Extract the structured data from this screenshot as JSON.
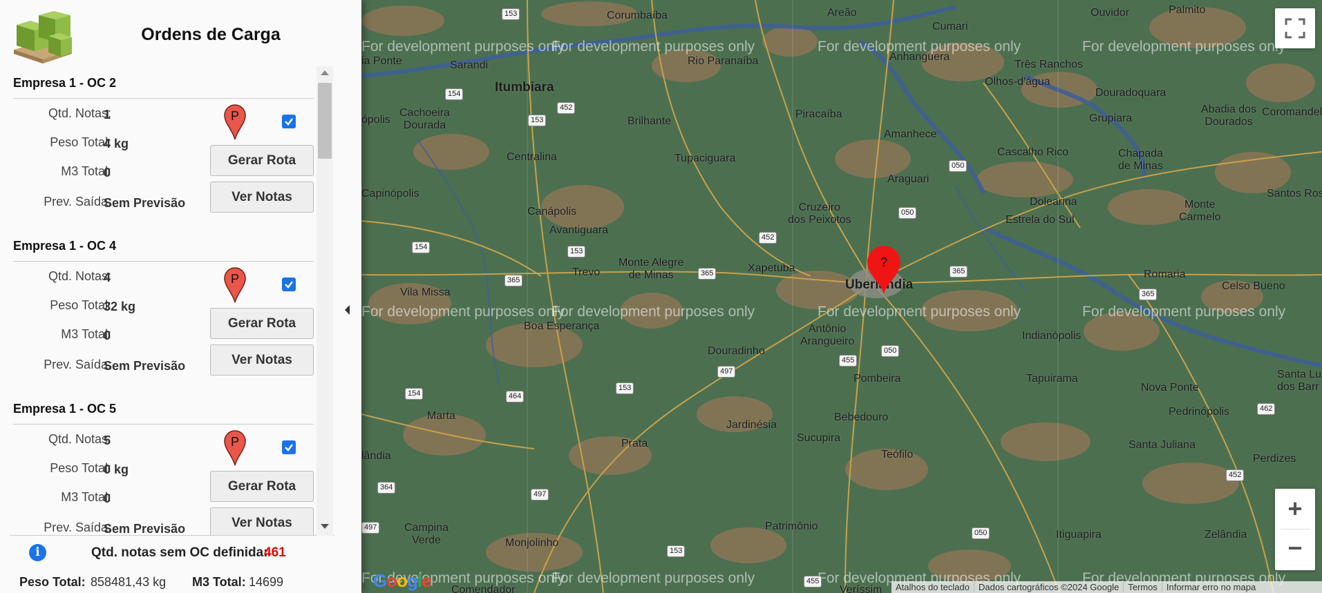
{
  "sidebar": {
    "title": "Ordens de Carga",
    "labels": {
      "qtd_notas": "Qtd. Notas:",
      "peso_total": "Peso Total:",
      "m3_total": "M3 Total:",
      "prev_saida": "Prev. Saída:"
    },
    "buttons": {
      "gerar_rota": "Gerar Rota",
      "ver_notas": "Ver Notas"
    },
    "pin_letter": "P",
    "orders": [
      {
        "title": "Empresa 1 - OC 2",
        "qtd_notas": "1",
        "peso_total": "4 kg",
        "m3_total": "0",
        "prev_saida": "Sem Previsão",
        "checked": true
      },
      {
        "title": "Empresa 1 - OC 4",
        "qtd_notas": "4",
        "peso_total": "32 kg",
        "m3_total": "0",
        "prev_saida": "Sem Previsão",
        "checked": true
      },
      {
        "title": "Empresa 1 - OC 5",
        "qtd_notas": "5",
        "peso_total": "0 kg",
        "m3_total": "0",
        "prev_saida": "Sem Previsão",
        "checked": true
      }
    ],
    "footer": {
      "info_glyph": "i",
      "sem_oc_label": "Qtd. notas sem OC definida:",
      "sem_oc_value": "461",
      "peso_label": "Peso Total:",
      "peso_value": "858481,43 kg",
      "m3_label": "M3 Total:",
      "m3_value": "14699"
    }
  },
  "map": {
    "watermark": "For development purposes only",
    "marker_label": "?",
    "zoom_in": "+",
    "zoom_out": "−",
    "google_logo": "Google",
    "attribution": [
      "Atalhos do teclado",
      "Dados cartográficos ©2024 Google",
      "Termos",
      "Informar erro no mapa"
    ],
    "places": {
      "corumbaiba": "Corumbaíba",
      "areao": "Areão",
      "cumari": "Cumari",
      "ouvidor": "Ouvidor",
      "palmito": "Palmito",
      "itaipe": "ia Ponte",
      "sarandi": "Sarandi",
      "rio_paranaiba": "Rio Paranaíba",
      "anhanguera": "Anhanguera",
      "tres_ranchos": "Três Ranchos",
      "olhos_dagua": "Olhos-d'água",
      "douradoquara": "Douradoquara",
      "itumbiara": "Itumbiara",
      "cachoeira_dourada": "Cachoeira\nDourada",
      "abadia": "Abadia dos\nDourados",
      "coromandel": "Coromandel",
      "pojolis": "ópolis",
      "brilhante": "Brilhante",
      "piracaiba": "Piracaíba",
      "grupiara": "Grupiara",
      "amanhece": "Amanhece",
      "cascalho_rico": "Cascalho Rico",
      "chapada": "Chapada\nde Minas",
      "centralina": "Centralina",
      "tupaciguara": "Tupaciguara",
      "araguari": "Araguari",
      "capinopolis": "Capinópolis",
      "dolearina": "Dolearina",
      "monte_carmelo": "Monte\nCarmelo",
      "santos_rosa": "Santos Rosa",
      "canapolis": "Canápolis",
      "cruzeiro": "Cruzeiro\ndos Peixotos",
      "estrela_sul": "Estrela do Sul",
      "avantiguara": "Avantiguara",
      "trevo": "Trevo",
      "monte_alegre": "Monte Alegre\nde Minas",
      "xapetuba": "Xapetuba",
      "uberlandia": "Uberlândia",
      "romaria": "Romaria",
      "celso_bueno": "Celso Bueno",
      "vila_missa": "Vila Missa",
      "boa_esperanca": "Boa Esperança",
      "antonio_arangueiro": "Antônio\nArangueiro",
      "indianopolis": "Indianópolis",
      "douradinho": "Douradinho",
      "pombeira": "Pombeira",
      "tapuirama": "Tapuirama",
      "nova_ponte": "Nova Ponte",
      "santa_luzia": "Santa Lu\ndos Barr",
      "marta": "Marta",
      "bebedouro": "Bebedouro",
      "pedrinopolis": "Pedrinópolis",
      "jardinesia": "Jardinésia",
      "prata": "Prata",
      "sucupira": "Sucupira",
      "santa_juliana": "Santa Juliana",
      "teofilo": "Teófilo",
      "perdizes": "Perdizes",
      "landia": "lândia",
      "campina_verde": "Campina\nVerde",
      "monjolinho": "Monjolinho",
      "patrimonio": "Patrimônio",
      "itiguapira": "Itiguapira",
      "zelandia": "Zelândia",
      "comendador": "Comendador",
      "verissimo": "Veríssim"
    },
    "shields": [
      "153",
      "154",
      "452",
      "153",
      "050",
      "452",
      "050",
      "154",
      "153",
      "365",
      "365",
      "365",
      "365",
      "050",
      "497",
      "455",
      "153",
      "464",
      "154",
      "497",
      "153",
      "050",
      "462",
      "452",
      "497",
      "364",
      "455"
    ]
  }
}
